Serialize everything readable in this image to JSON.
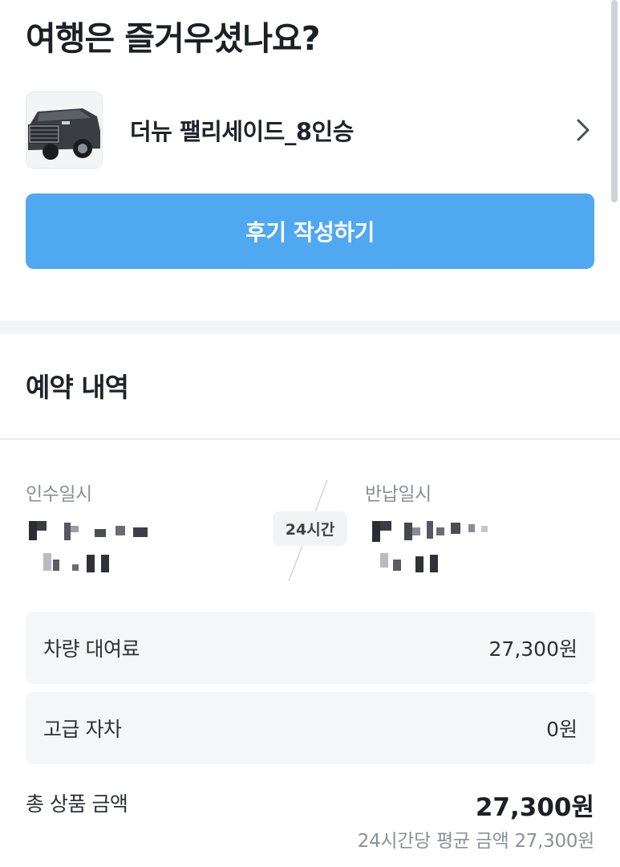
{
  "header": {
    "title": "여행은 즐거우셨나요?"
  },
  "car": {
    "name": "더뉴 팰리세이드_8인승",
    "image_icon": "car-photo"
  },
  "review_button": {
    "label": "후기 작성하기"
  },
  "reservation": {
    "section_title": "예약 내역",
    "pickup_label": "인수일시",
    "return_label": "반납일시",
    "duration_badge": "24시간"
  },
  "prices": {
    "rental_fee_label": "차량 대여료",
    "rental_fee_value": "27,300원",
    "self_coverage_label": "고급 자차",
    "self_coverage_value": "0원",
    "total_label": "총 상품 금액",
    "total_value": "27,300원",
    "average_note": "24시간당 평균 금액 27,300원"
  },
  "colors": {
    "accent": "#4fa8f0",
    "panel": "#f5f6f8"
  }
}
